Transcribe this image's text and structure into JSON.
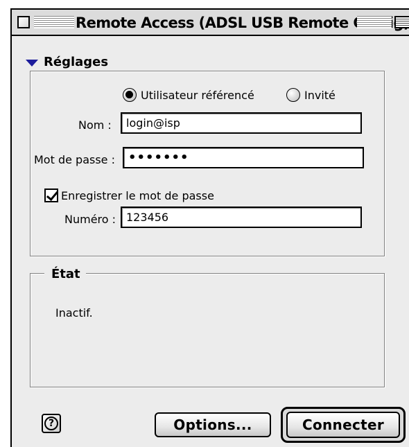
{
  "window": {
    "title": "Remote Access (ADSL USB Remote Config)"
  },
  "settings": {
    "section_label": "Réglages",
    "radio_registered": "Utilisateur référencé",
    "radio_guest": "Invité",
    "selected_radio": "registered",
    "name_label": "Nom :",
    "name_value": "login@isp",
    "password_label": "Mot de passe :",
    "password_value": "•••••••",
    "save_password_label": "Enregistrer le mot de passe",
    "save_password_checked": true,
    "number_label": "Numéro :",
    "number_value": "123456"
  },
  "state": {
    "title": "État",
    "text": "Inactif."
  },
  "buttons": {
    "help_symbol": "?",
    "options": "Options...",
    "connect": "Connecter"
  },
  "icons": {
    "disclosure": "disclosure-triangle-icon",
    "help": "help-icon",
    "close": "close-box-icon",
    "zoom": "zoom-box-icon"
  },
  "colors": {
    "window_bg": "#ececec",
    "disclosure_triangle": "#1c1c9c"
  }
}
